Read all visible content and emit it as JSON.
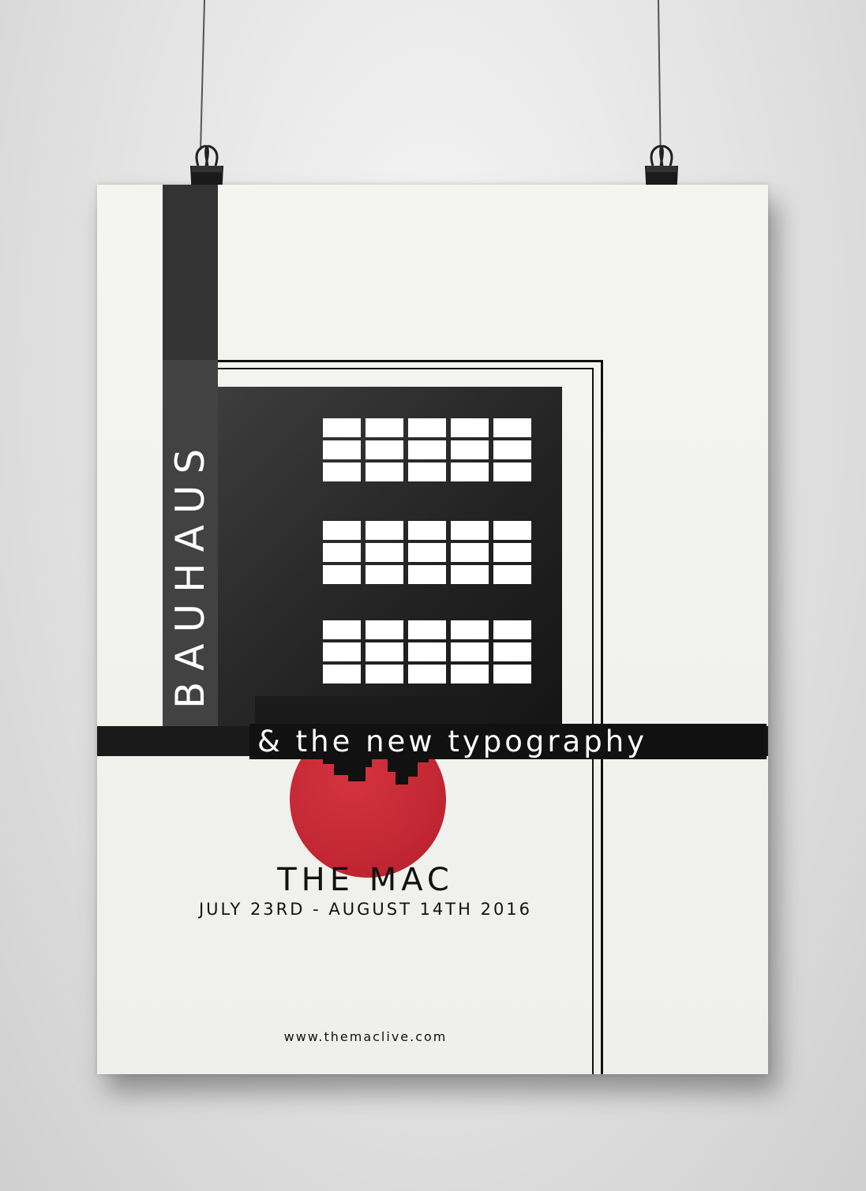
{
  "poster": {
    "title": "BAUHAUS",
    "subtitle": "& the new typography",
    "venue": "THE MAC",
    "dates": "JULY 23RD - AUGUST 14TH 2016",
    "url": "www.themaclive.com"
  },
  "colors": {
    "paper": "#efefec",
    "black": "#111111",
    "red": "#c0222e",
    "wall": "#dcdcdc"
  },
  "icons": [
    "binder-clip-icon",
    "binder-clip-icon"
  ]
}
